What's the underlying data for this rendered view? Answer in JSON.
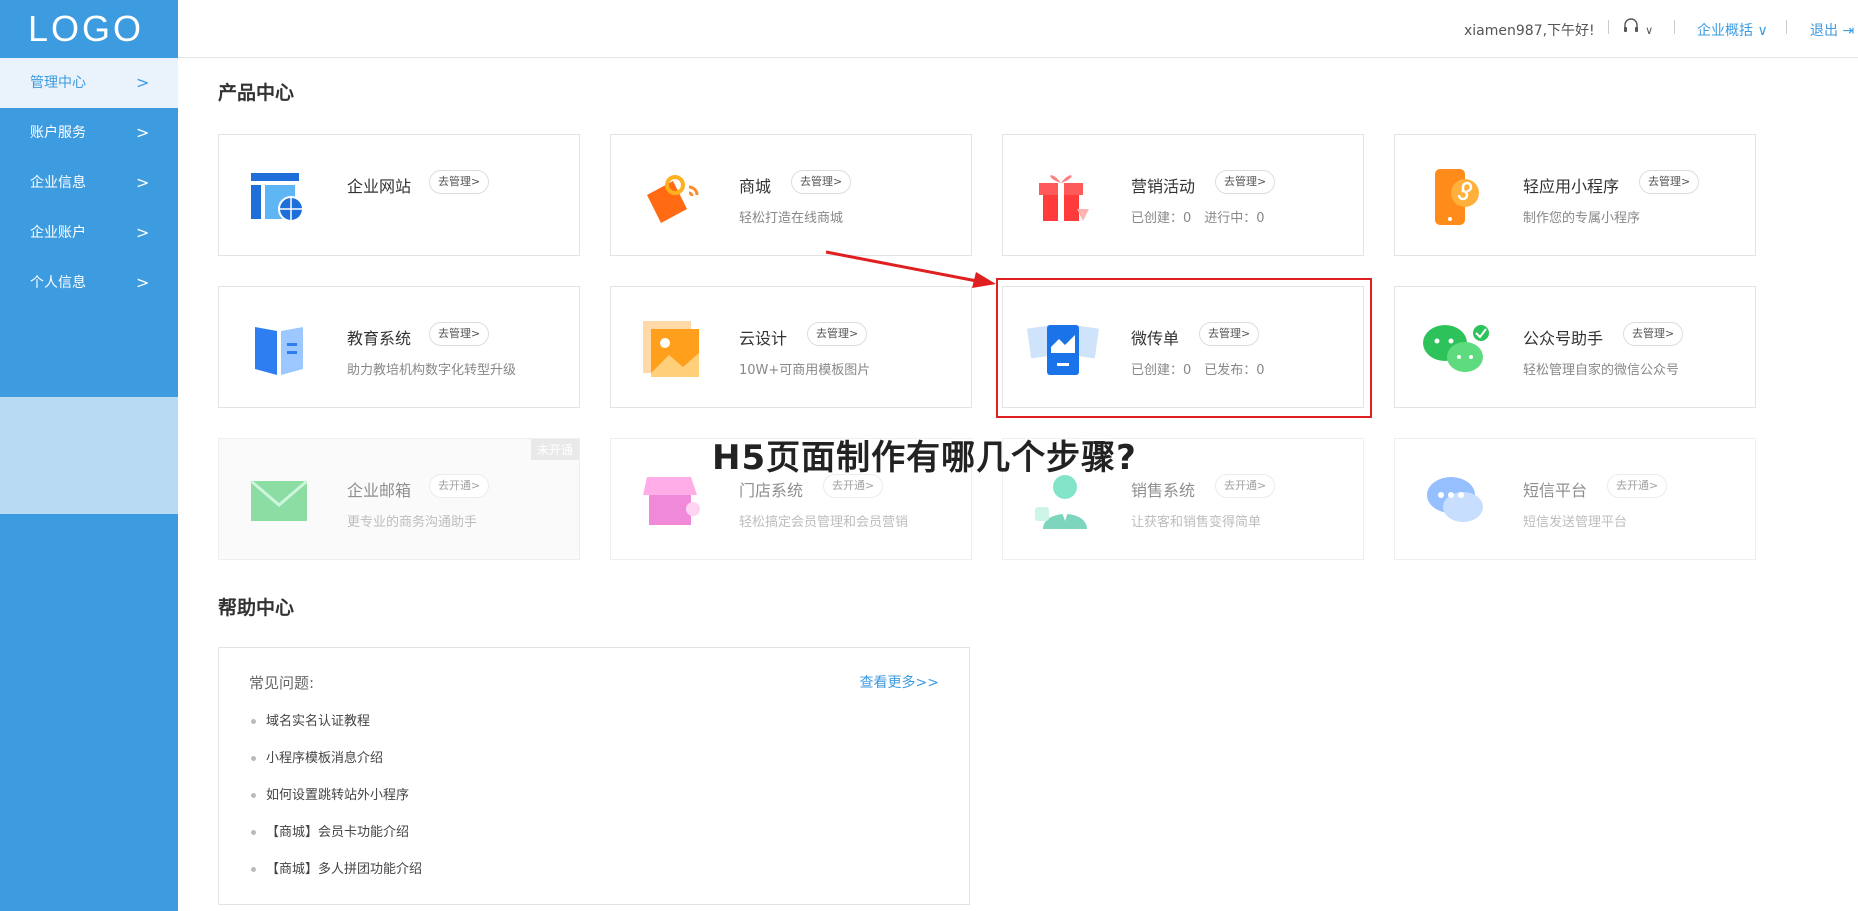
{
  "sidebar": {
    "logo": "LOGO",
    "items": [
      {
        "label": "管理中心"
      },
      {
        "label": "账户服务"
      },
      {
        "label": "企业信息"
      },
      {
        "label": "企业账户"
      },
      {
        "label": "个人信息"
      }
    ],
    "chevron": ">"
  },
  "header": {
    "greeting": "xiamen987,下午好!",
    "support_chevron": "∨",
    "overview": "企业概括 ∨",
    "logout": "退出 ⇥"
  },
  "products": {
    "title": "产品中心",
    "manage_label": "去管理>",
    "open_label": "去开通>",
    "closed_badge": "未开通",
    "cards": [
      {
        "name": "企业网站",
        "desc": ""
      },
      {
        "name": "商城",
        "desc": "轻松打造在线商城"
      },
      {
        "name": "营销活动",
        "desc": "已创建：0　进行中：0"
      },
      {
        "name": "轻应用小程序",
        "desc": "制作您的专属小程序"
      },
      {
        "name": "教育系统",
        "desc": "助力教培机构数字化转型升级"
      },
      {
        "name": "云设计",
        "desc": "10W+可商用模板图片"
      },
      {
        "name": "微传单",
        "desc": "已创建：0　已发布：0"
      },
      {
        "name": "公众号助手",
        "desc": "轻松管理自家的微信公众号"
      },
      {
        "name": "企业邮箱",
        "desc": "更专业的商务沟通助手"
      },
      {
        "name": "门店系统",
        "desc": "轻松搞定会员管理和会员营销"
      },
      {
        "name": "销售系统",
        "desc": "让获客和销售变得简单"
      },
      {
        "name": "短信平台",
        "desc": "短信发送管理平台"
      }
    ]
  },
  "overlay_title": "H5页面制作有哪几个步骤?",
  "help": {
    "title": "帮助中心",
    "faq_label": "常见问题:",
    "more": "查看更多>>",
    "items": [
      "域名实名认证教程",
      "小程序模板消息介绍",
      "如何设置跳转站外小程序",
      "【商城】会员卡功能介绍",
      "【商城】多人拼团功能介绍"
    ]
  },
  "colors": {
    "brand": "#3d9be0",
    "highlight": "#e02020"
  }
}
